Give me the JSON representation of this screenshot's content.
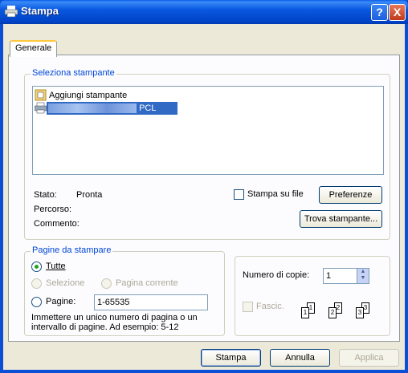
{
  "window": {
    "title": "Stampa",
    "help_button": "?",
    "close_button": "X"
  },
  "tabs": [
    {
      "label": "Generale"
    }
  ],
  "printer_group": {
    "title": "Seleziona stampante",
    "printers": [
      {
        "label": "Aggiungi stampante"
      },
      {
        "label": "PCL"
      }
    ],
    "status_label": "Stato:",
    "status_value": "Pronta",
    "location_label": "Percorso:",
    "comment_label": "Commento:",
    "print_to_file_label": "Stampa su file",
    "preferences_label": "Preferenze",
    "find_printer_label": "Trova stampante..."
  },
  "pages_group": {
    "title": "Pagine da stampare",
    "all_label": "Tutte",
    "selection_label": "Selezione",
    "current_page_label": "Pagina corrente",
    "pages_label": "Pagine:",
    "pages_value": "1-65535",
    "help_text": "Immettere un unico numero di pagina o un intervallo di pagine. Ad esempio: 5-12"
  },
  "copies_group": {
    "copies_label": "Numero di copie:",
    "copies_value": "1",
    "collate_label": "Fascic.",
    "collate_sets": [
      {
        "front": "1",
        "back": "1"
      },
      {
        "front": "2",
        "back": "2"
      },
      {
        "front": "3",
        "back": "3"
      }
    ]
  },
  "footer": {
    "print_label": "Stampa",
    "cancel_label": "Annulla",
    "apply_label": "Applica"
  }
}
